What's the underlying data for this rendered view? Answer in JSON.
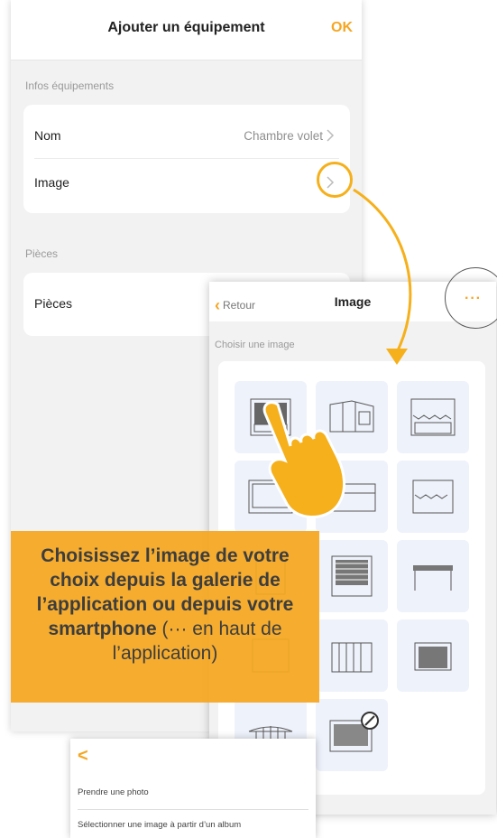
{
  "main_screen": {
    "title": "Ajouter un équipement",
    "ok_label": "OK",
    "section_info": "Infos équipements",
    "rows": [
      {
        "label": "Nom",
        "value": "Chambre volet"
      },
      {
        "label": "Image",
        "value": ""
      }
    ],
    "section_rooms": "Pièces",
    "rooms_row": {
      "label": "Pièces"
    }
  },
  "image_screen": {
    "back_label": "Retour",
    "title": "Image",
    "more_label": "···",
    "choose_label": "Choisir une image"
  },
  "overlay": {
    "line_bold": "Choisissez l’image de votre choix depuis la galerie de l’application ou depuis votre smartphone",
    "line_normal": " (··· en haut de l’application)"
  },
  "action_sheet": {
    "back_label": "<",
    "take_photo": "Prendre une photo",
    "select_album": "Sélectionner une image à partir d’un album"
  },
  "colors": {
    "accent": "#f5a623",
    "overlay_bg": "#f4a824",
    "tile_bg": "#eef2fb"
  },
  "icons": [
    "chevron-right-icon",
    "chevron-left-icon",
    "more-dots-icon",
    "hand-pointer-icon",
    "curved-arrow-icon"
  ]
}
